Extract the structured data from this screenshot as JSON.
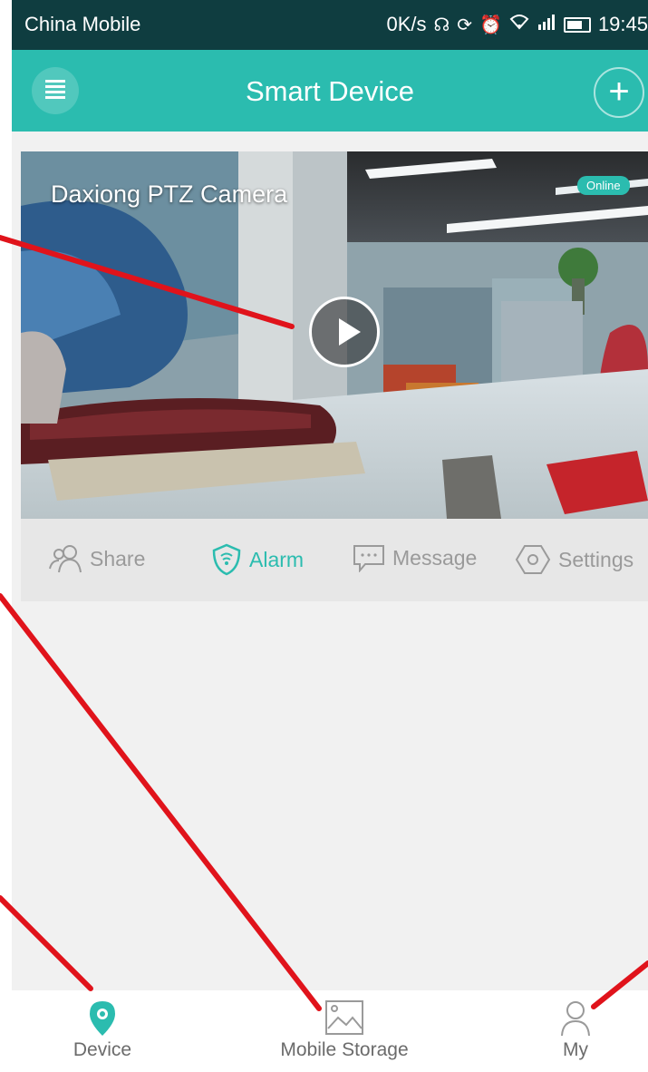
{
  "status_bar": {
    "carrier": "China Mobile",
    "speed": "0K/s",
    "time": "19:45",
    "icons": [
      "headset-icon",
      "sync-icon",
      "alarm-icon",
      "wifi-icon",
      "signal-icon",
      "battery-icon"
    ]
  },
  "header": {
    "title": "Smart Device",
    "menu_icon": "menu-icon",
    "add_icon": "add-icon"
  },
  "camera": {
    "name": "Daxiong PTZ Camera",
    "status": "Online",
    "actions": [
      {
        "label": "Share",
        "icon": "share-icon",
        "active": false
      },
      {
        "label": "Alarm",
        "icon": "alarm-shield-icon",
        "active": true
      },
      {
        "label": "Message",
        "icon": "message-icon",
        "active": false
      },
      {
        "label": "Settings",
        "icon": "settings-icon",
        "active": false
      }
    ]
  },
  "bottom_nav": {
    "items": [
      {
        "label": "Device",
        "icon": "location-pin-icon",
        "active": true
      },
      {
        "label": "Mobile Storage",
        "icon": "image-icon",
        "active": false
      },
      {
        "label": "My",
        "icon": "person-icon",
        "active": false
      }
    ]
  },
  "colors": {
    "accent": "#2bbcaf",
    "status_bar": "#0f3d40",
    "annotation": "#e0131b",
    "inactive_text": "#9a9a9a"
  }
}
